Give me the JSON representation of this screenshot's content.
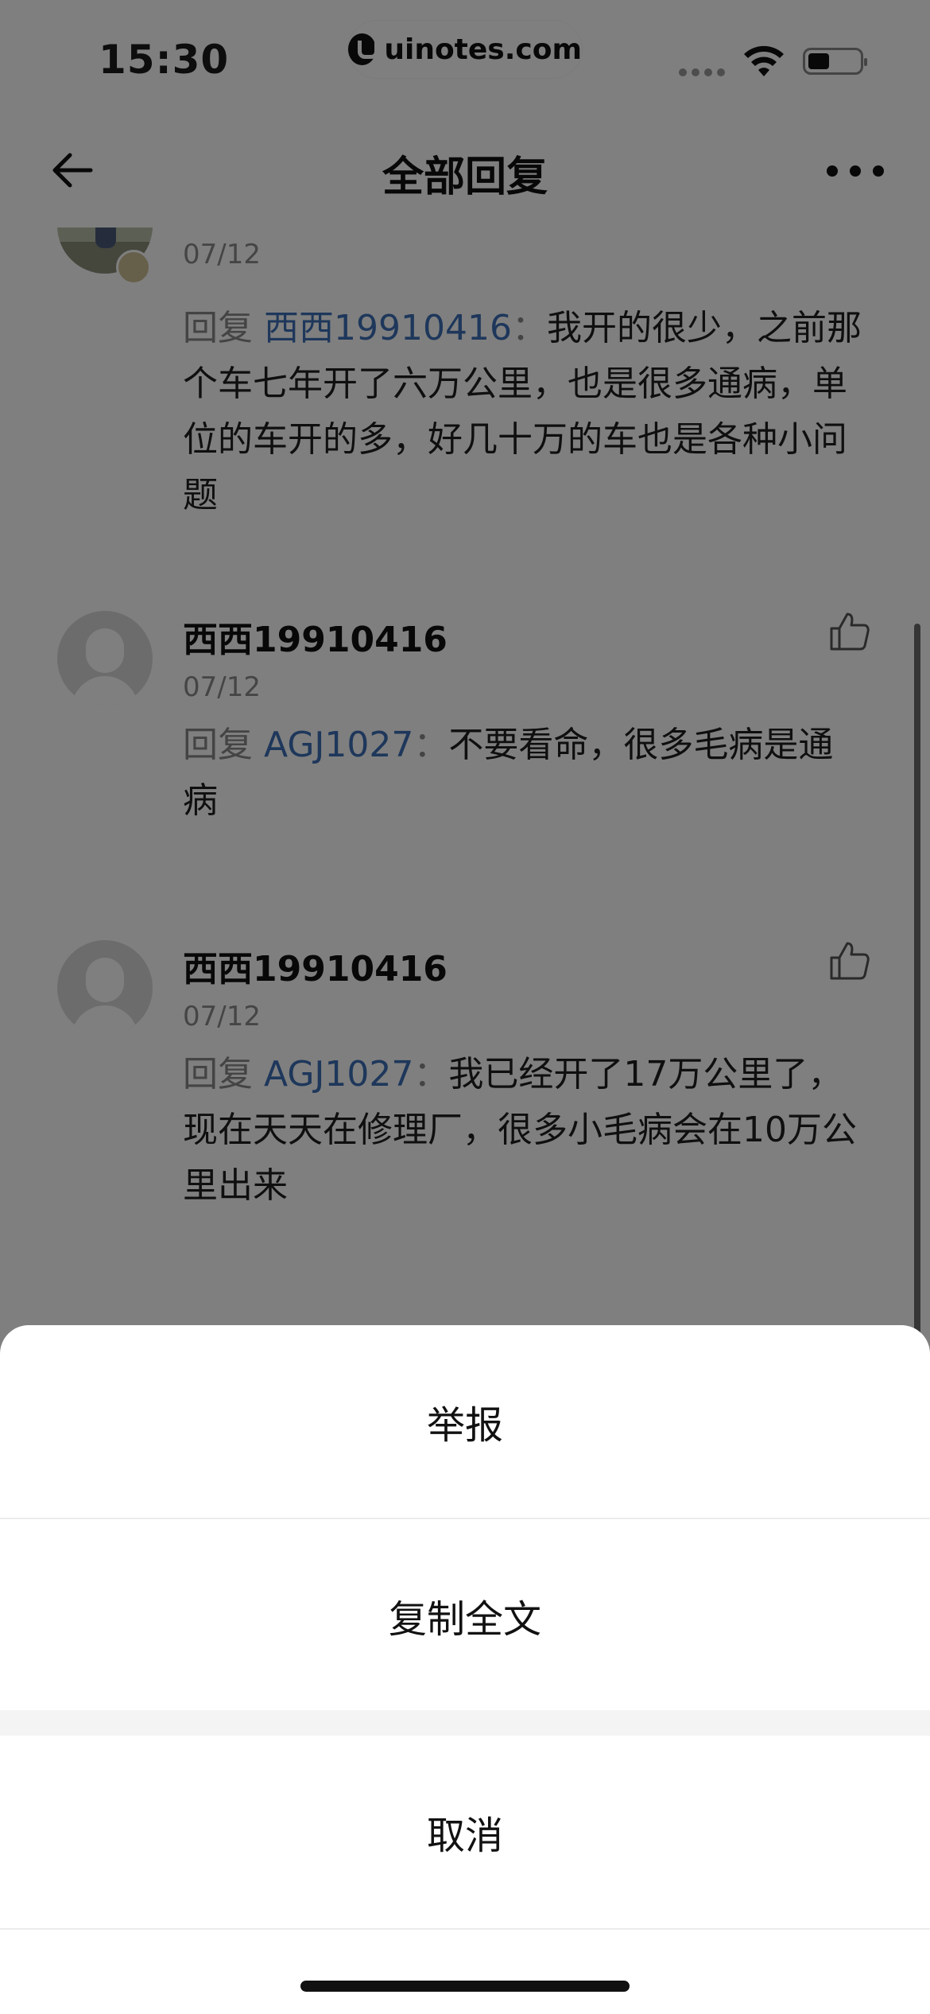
{
  "status_bar": {
    "time": "15:30",
    "watermark": "uinotes.com",
    "icons": [
      "signal-icon",
      "wifi-icon",
      "battery-icon"
    ]
  },
  "nav": {
    "title": "全部回复",
    "back_icon": "arrow-left-icon",
    "more_icon": "more-horizontal-icon"
  },
  "comments": [
    {
      "username": "",
      "date": "07/12",
      "reply_prefix": "回复",
      "reply_target": "西西19910416",
      "reply_colon": "：",
      "text": "我开的很少，之前那个车七年开了六万公里，也是很多通病，单位的车开的多，好几十万的车也是各种小问题"
    },
    {
      "username": "西西19910416",
      "date": "07/12",
      "reply_prefix": "回复",
      "reply_target": "AGJ1027",
      "reply_colon": "：",
      "text": "不要看命，很多毛病是通病"
    },
    {
      "username": "西西19910416",
      "date": "07/12",
      "reply_prefix": "回复",
      "reply_target": "AGJ1027",
      "reply_colon": "：",
      "text": "我已经开了17万公里了，现在天天在修理厂，很多小毛病会在10万公里出来"
    }
  ],
  "action_sheet": {
    "report": "举报",
    "copy_all": "复制全文",
    "cancel": "取消"
  },
  "colors": {
    "reply_target": "#3d6fb6",
    "muted": "#888888",
    "overlay": "rgba(0,0,0,0.5)"
  }
}
